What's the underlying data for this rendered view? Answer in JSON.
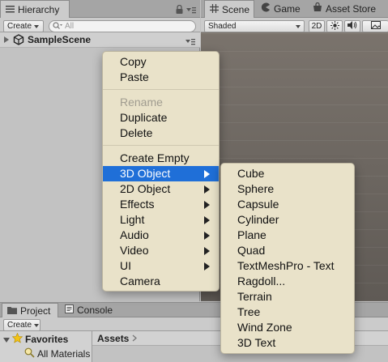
{
  "hierarchy": {
    "tab_label": "Hierarchy",
    "create_label": "Create",
    "search_placeholder": "All",
    "scene_name": "SampleScene"
  },
  "scene_view": {
    "tabs": [
      {
        "label": "Scene",
        "icon": "grid-icon"
      },
      {
        "label": "Game",
        "icon": "pacman-icon"
      },
      {
        "label": "Asset Store",
        "icon": "store-icon"
      }
    ],
    "shading_mode": "Shaded",
    "mode_2d": "2D"
  },
  "project": {
    "tabs": [
      {
        "label": "Project",
        "icon": "folder-icon"
      },
      {
        "label": "Console",
        "icon": "console-icon"
      }
    ],
    "create_label": "Create",
    "favorites_label": "Favorites",
    "favorites_items": [
      "All Materials"
    ],
    "assets_label": "Assets"
  },
  "context_menu": {
    "items": [
      {
        "label": "Copy"
      },
      {
        "label": "Paste"
      },
      {
        "label": "Rename",
        "disabled": true
      },
      {
        "label": "Duplicate"
      },
      {
        "label": "Delete"
      },
      {
        "label": "Create Empty"
      },
      {
        "label": "3D Object",
        "submenu": true,
        "selected": true
      },
      {
        "label": "2D Object",
        "submenu": true
      },
      {
        "label": "Effects",
        "submenu": true
      },
      {
        "label": "Light",
        "submenu": true
      },
      {
        "label": "Audio",
        "submenu": true
      },
      {
        "label": "Video",
        "submenu": true
      },
      {
        "label": "UI",
        "submenu": true
      },
      {
        "label": "Camera"
      }
    ]
  },
  "submenu_3d_object": {
    "items": [
      "Cube",
      "Sphere",
      "Capsule",
      "Cylinder",
      "Plane",
      "Quad",
      "TextMeshPro - Text",
      "Ragdoll...",
      "Terrain",
      "Tree",
      "Wind Zone",
      "3D Text"
    ]
  },
  "colors": {
    "menu_bg": "#e9e2c9",
    "selection": "#1f6fd8",
    "panel_bg": "#c2c2c2",
    "viewport_bg": "#6f6a64"
  }
}
